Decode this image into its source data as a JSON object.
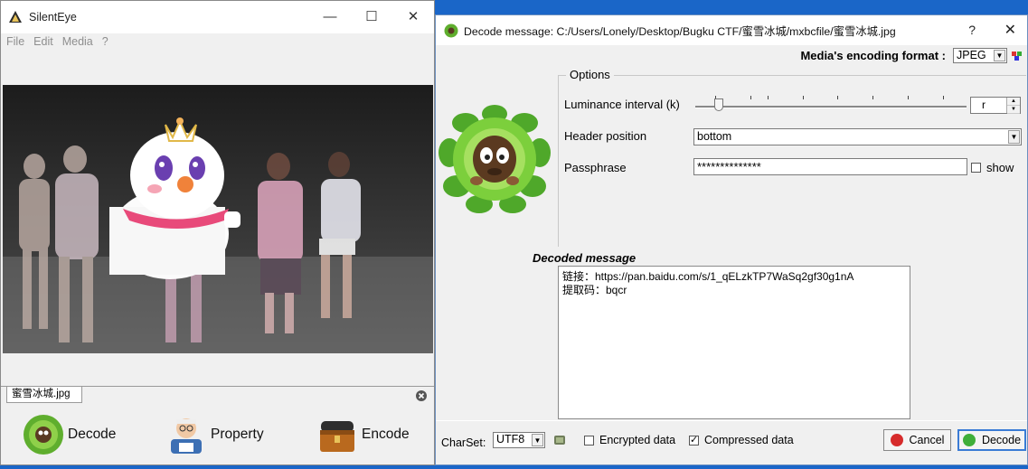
{
  "main_window": {
    "title": "SilentEye",
    "controls": {
      "minimize": "—",
      "maximize": "☐",
      "close": "✕"
    },
    "menu": [
      "File",
      "Edit",
      "Media",
      "?"
    ],
    "file_tab": "蜜雪冰城.jpg",
    "actions": {
      "decode": "Decode",
      "property": "Property",
      "encode": "Encode"
    }
  },
  "decode_dialog": {
    "title": "Decode message: C:/Users/Lonely/Desktop/Bugku CTF/蜜雪冰城/mxbcfile/蜜雪冰城.jpg",
    "help": "?",
    "close": "✕",
    "format_label": "Media's encoding format :",
    "format_value": "JPEG",
    "options_title": "Options",
    "luminance_label": "Luminance interval (k)",
    "luminance_value": "r",
    "header_label": "Header position",
    "header_value": "bottom",
    "passphrase_label": "Passphrase",
    "passphrase_value": "**************",
    "show_label": "show",
    "show_checked": false,
    "decoded_heading": "Decoded message",
    "decoded_lines": [
      "链接：https://pan.baidu.com/s/1_qELzkTP7WaSq2gf30g1nA",
      "提取码：bqcr"
    ],
    "charset_label": "CharSet:",
    "charset_value": "UTF8",
    "encrypted_label": "Encrypted data",
    "encrypted_checked": false,
    "compressed_label": "Compressed data",
    "compressed_checked": true,
    "cancel_label": "Cancel",
    "decode_label": "Decode"
  },
  "colors": {
    "desktop": "#1a66c8",
    "window_bg": "#f0f0f0",
    "accent": "#3a7bd5"
  }
}
